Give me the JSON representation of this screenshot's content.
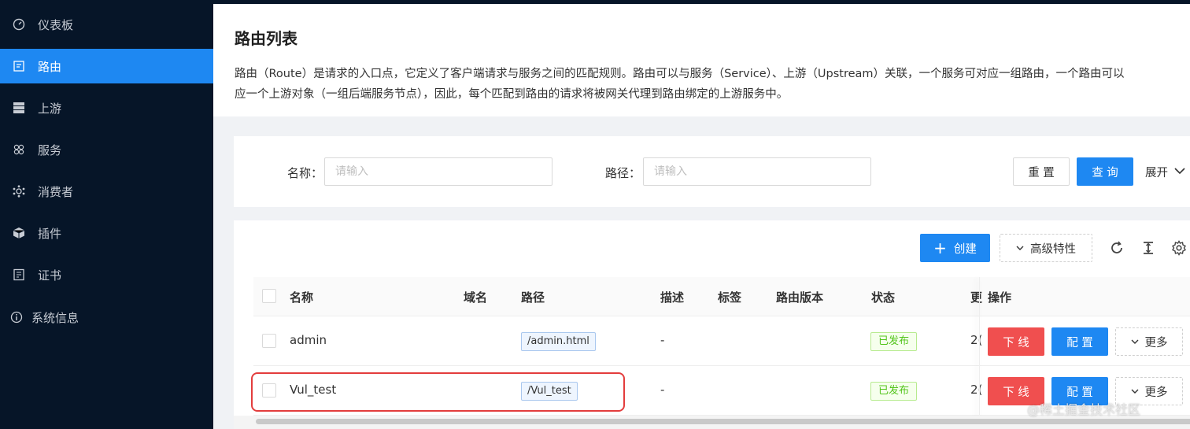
{
  "sidebar": {
    "items": [
      {
        "label": "仪表板",
        "icon": "dashboard-icon"
      },
      {
        "label": "路由",
        "icon": "route-icon",
        "active": true
      },
      {
        "label": "上游",
        "icon": "upstream-icon"
      },
      {
        "label": "服务",
        "icon": "service-icon"
      },
      {
        "label": "消费者",
        "icon": "consumer-icon"
      },
      {
        "label": "插件",
        "icon": "plugin-icon"
      },
      {
        "label": "证书",
        "icon": "certificate-icon"
      },
      {
        "label": "系统信息",
        "icon": "info-icon"
      }
    ]
  },
  "header": {
    "title": "路由列表",
    "desc_line1": "路由（Route）是请求的入口点，它定义了客户端请求与服务之间的匹配规则。路由可以与服务（Service）、上游（Upstream）关联，一个服务可对应一组路由，一个路由可以",
    "desc_line2": "应一个上游对象（一组后端服务节点），因此，每个匹配到路由的请求将被网关代理到路由绑定的上游服务中。"
  },
  "search": {
    "name_label": "名称：",
    "name_placeholder": "请输入",
    "path_label": "路径：",
    "path_placeholder": "请输入",
    "reset_label": "重 置",
    "query_label": "查 询",
    "expand_label": "展开"
  },
  "toolbar": {
    "create_label": "创建",
    "advanced_label": "高级特性"
  },
  "table": {
    "columns": {
      "name": "名称",
      "domain": "域名",
      "path": "路径",
      "desc": "描述",
      "labels": "标签",
      "version": "路由版本",
      "status": "状态",
      "updated": "更",
      "ops": "操作"
    },
    "rows": [
      {
        "name": "admin",
        "path": "/admin.html",
        "desc": "-",
        "status": "已发布",
        "updated": "2(",
        "offline": "下 线",
        "config": "配 置",
        "more": "更多"
      },
      {
        "name": "Vul_test",
        "path": "/Vul_test",
        "desc": "-",
        "status": "已发布",
        "updated": "2(",
        "offline": "下 线",
        "config": "配 置",
        "more": "更多"
      }
    ]
  },
  "watermark": "@稀土掘金技术社区",
  "colors": {
    "sidebar_bg": "#061528",
    "accent": "#1e88f2",
    "danger": "#f04f4f",
    "success": "#52c41a",
    "highlight": "#e33d3d"
  }
}
